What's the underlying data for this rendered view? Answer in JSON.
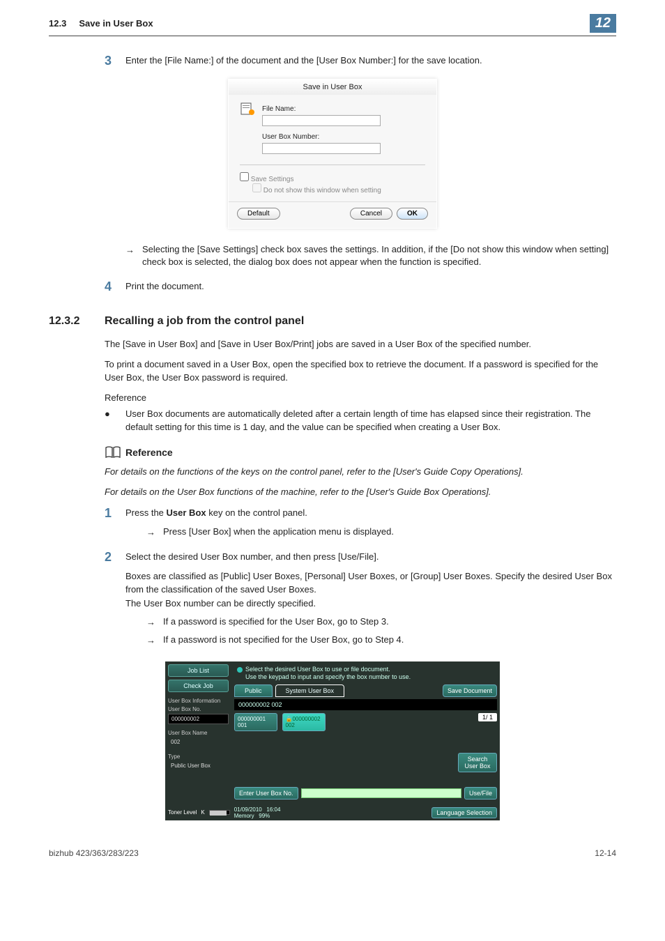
{
  "header": {
    "section": "12.3",
    "title": "Save in User Box",
    "chapter": "12"
  },
  "step3": {
    "num": "3",
    "text": "Enter the [File Name:] of the document and the [User Box Number:] for the save location.",
    "tip": "Selecting the [Save Settings] check box saves the settings. In addition, if the [Do not show this window when setting] check box is selected, the dialog box does not appear when the function is specified."
  },
  "dialog": {
    "title": "Save in User Box",
    "file_name_label": "File Name:",
    "user_box_label": "User Box Number:",
    "save_settings": "Save Settings",
    "do_not_show": "Do not show this window when setting",
    "default_btn": "Default",
    "cancel_btn": "Cancel",
    "ok_btn": "OK"
  },
  "step4": {
    "num": "4",
    "text": "Print the document."
  },
  "subsection": {
    "num": "12.3.2",
    "title": "Recalling a job from the control panel"
  },
  "body": {
    "p1": "The [Save in User Box] and [Save in User Box/Print] jobs are saved in a User Box of the specified number.",
    "p2": "To print a document saved in a User Box, open the specified box to retrieve the document. If a password is specified for the User Box, the User Box password is required.",
    "ref_label": "Reference",
    "bullet1": "User Box documents are automatically deleted after a certain length of time has elapsed since their registration. The default setting for this time is 1 day, and the value can be specified when creating a User Box."
  },
  "reference": {
    "head": "Reference",
    "line1": "For details on the functions of the keys on the control panel, refer to the [User's Guide Copy Operations].",
    "line2": "For details on the User Box functions of the machine, refer to the [User's Guide Box Operations]."
  },
  "proc": {
    "s1_num": "1",
    "s1_a": "Press the ",
    "s1_b": "User Box",
    "s1_c": " key on the control panel.",
    "s1_tip": "Press [User Box] when the application menu is displayed.",
    "s2_num": "2",
    "s2_main": "Select the desired User Box number, and then press [Use/File].",
    "s2_p1": "Boxes are classified as [Public] User Boxes, [Personal] User Boxes, or [Group] User Boxes. Specify the desired User Box from the classification of the saved User Boxes.",
    "s2_p2": "The User Box number can be directly specified.",
    "s2_tip1": "If a password is specified for the User Box, go to Step 3.",
    "s2_tip2": "If a password is not specified for the User Box, go to Step 4."
  },
  "panel": {
    "job_list": "Job List",
    "check_job": "Check Job",
    "info_label": "User Box Information",
    "ub_no_label": "User Box No.",
    "ub_no_value": "000000002",
    "ub_name_label": "User Box Name",
    "ub_name_value": "002",
    "type_label": "Type",
    "type_value": "Public User Box",
    "toner_label": "Toner Level",
    "toner_k": "K",
    "hint1": "Select the desired User Box to use or file document.",
    "hint2": "Use the keypad to input and specify the box number to use.",
    "tab_public": "Public",
    "tab_system": "System User Box",
    "save_doc": "Save Document",
    "blackbar": "000000002   002",
    "box1_no": "000000001",
    "box1_name": "001",
    "box2_no": "000000002",
    "box2_name": "002",
    "page_ind": "1/ 1",
    "search": "Search User Box",
    "enter_btn": "Enter User Box No.",
    "use_file": "Use/File",
    "date": "01/09/2010",
    "time": "16:04",
    "mem_label": "Memory",
    "mem_val": "99%",
    "lang": "Language Selection"
  },
  "footer": {
    "left": "bizhub 423/363/283/223",
    "right": "12-14"
  }
}
